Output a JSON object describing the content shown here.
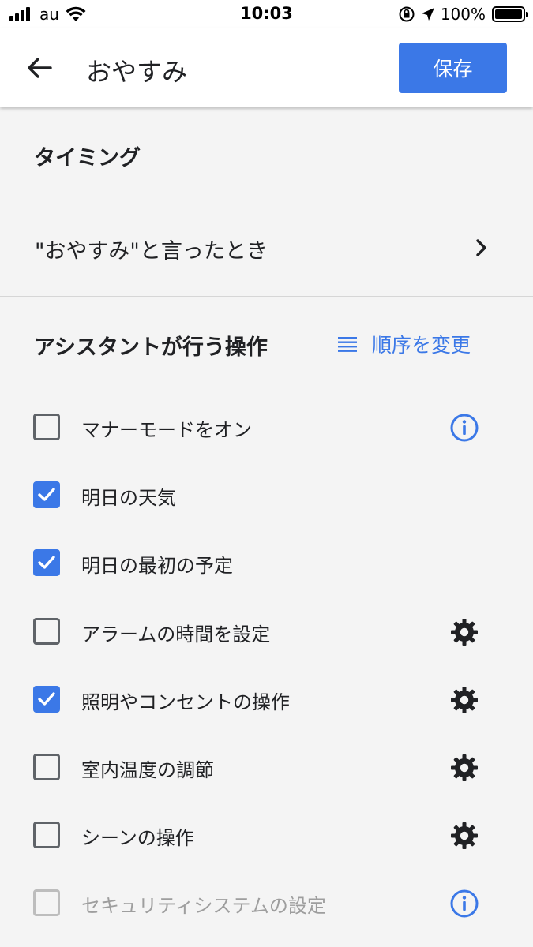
{
  "status_bar": {
    "carrier": "au",
    "time": "10:03",
    "battery": "100%"
  },
  "app_bar": {
    "title": "おやすみ",
    "save_label": "保存"
  },
  "timing": {
    "title": "タイミング",
    "trigger": "\"おやすみ\"と言ったとき"
  },
  "actions": {
    "title": "アシスタントが行う操作",
    "reorder_label": "順序を変更",
    "items": [
      {
        "label": "マナーモードをオン",
        "checked": false,
        "disabled": false,
        "trailing": "info-icon"
      },
      {
        "label": "明日の天気",
        "checked": true,
        "disabled": false,
        "trailing": ""
      },
      {
        "label": "明日の最初の予定",
        "checked": true,
        "disabled": false,
        "trailing": ""
      },
      {
        "label": "アラームの時間を設定",
        "checked": false,
        "disabled": false,
        "trailing": "gear-icon"
      },
      {
        "label": "照明やコンセントの操作",
        "checked": true,
        "disabled": false,
        "trailing": "gear-icon"
      },
      {
        "label": "室内温度の調節",
        "checked": false,
        "disabled": false,
        "trailing": "gear-icon"
      },
      {
        "label": "シーンの操作",
        "checked": false,
        "disabled": false,
        "trailing": "gear-icon"
      },
      {
        "label": "セキュリティシステムの設定",
        "checked": false,
        "disabled": true,
        "trailing": "info-icon"
      }
    ]
  },
  "colors": {
    "accent": "#3b78e7",
    "background": "#f4f4f4",
    "text": "#202124",
    "disabled": "#bdbdbd"
  }
}
